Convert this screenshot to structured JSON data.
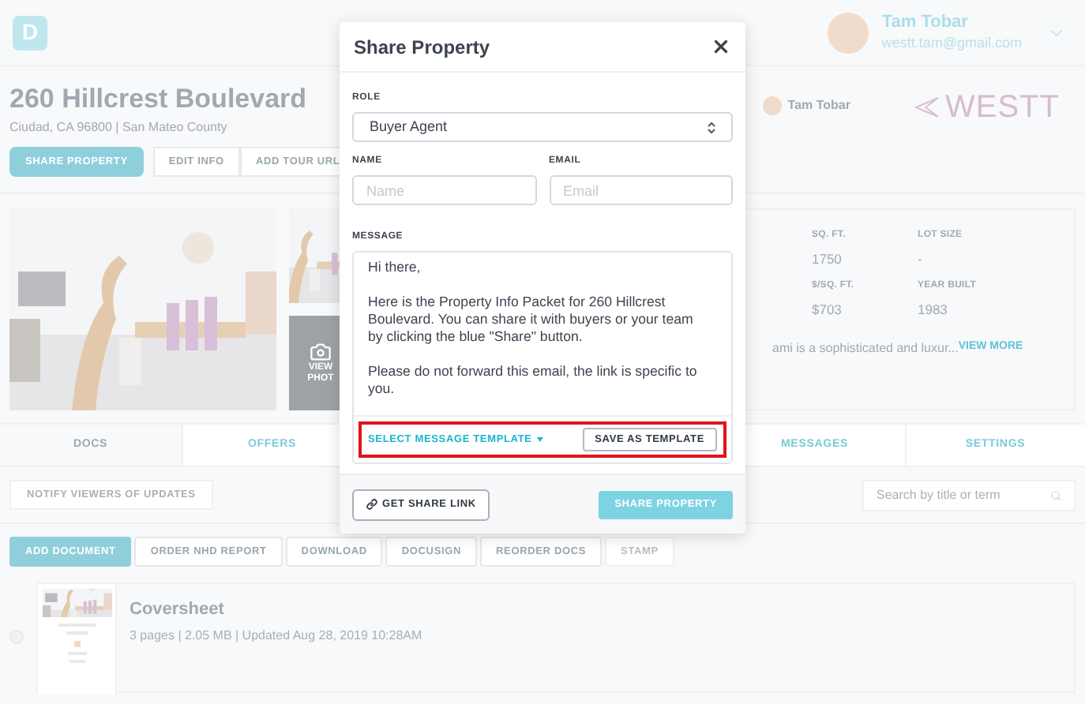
{
  "header": {
    "logo": "D",
    "user": {
      "name": "Tam Tobar",
      "email": "westt.tam@gmail.com"
    }
  },
  "property": {
    "title": "260 Hillcrest Boulevard",
    "subtitle": "Ciudad, CA 96800 | San Mateo County",
    "agent": "Tam Tobar",
    "brand": "WESTT",
    "actions": [
      {
        "label": "SHARE PROPERTY",
        "kind": "primary"
      },
      {
        "label": "EDIT INFO",
        "kind": "outline"
      },
      {
        "label": "ADD TOUR URL",
        "kind": "outline"
      }
    ]
  },
  "photos": {
    "view_label": [
      "VIEW",
      "PHOT"
    ]
  },
  "stats": [
    {
      "label": "SQ. FT.",
      "value": "1750"
    },
    {
      "label": "LOT SIZE",
      "value": "-"
    },
    {
      "label": "$/SQ. FT.",
      "value": "$703"
    },
    {
      "label": "YEAR BUILT",
      "value": "1983"
    }
  ],
  "description": "ami is a sophisticated and luxur...",
  "view_more": "VIEW MORE",
  "tabs": [
    {
      "label": "DOCS",
      "selected": true
    },
    {
      "label": "OFFERS",
      "selected": false
    },
    {
      "label": "MESSAGES",
      "selected": false
    },
    {
      "label": "SETTINGS",
      "selected": false
    }
  ],
  "notify": "NOTIFY VIEWERS OF UPDATES",
  "search": {
    "placeholder": "Search by title or term"
  },
  "doc_actions": [
    {
      "label": "ADD DOCUMENT",
      "kind": "primary"
    },
    {
      "label": "ORDER NHD REPORT",
      "kind": "outline"
    },
    {
      "label": "DOWNLOAD",
      "kind": "outline"
    },
    {
      "label": "DOCUSIGN",
      "kind": "outline"
    },
    {
      "label": "REORDER DOCS",
      "kind": "outline"
    },
    {
      "label": "STAMP",
      "kind": "disabled"
    }
  ],
  "documents": [
    {
      "title": "Coversheet",
      "meta": "3 pages | 2.05 MB | Updated Aug 28, 2019 10:28AM",
      "selected": false
    }
  ],
  "modal": {
    "title": "Share Property",
    "role": {
      "label": "ROLE",
      "value": "Buyer Agent"
    },
    "name": {
      "label": "NAME",
      "placeholder": "Name"
    },
    "email": {
      "label": "EMAIL",
      "placeholder": "Email"
    },
    "message": {
      "label": "MESSAGE",
      "paragraphs": [
        "Hi there,",
        "Here is the Property Info Packet for 260 Hillcrest Boulevard. You can share it with buyers or your team by clicking the blue \"Share\" button.",
        "Please do not forward this email, the link is specific to you."
      ]
    },
    "select_template": "SELECT MESSAGE TEMPLATE",
    "save_template": "SAVE AS TEMPLATE",
    "get_link": "GET SHARE LINK",
    "share": {
      "label": "SHARE PROPERTY",
      "disabled": true
    }
  }
}
